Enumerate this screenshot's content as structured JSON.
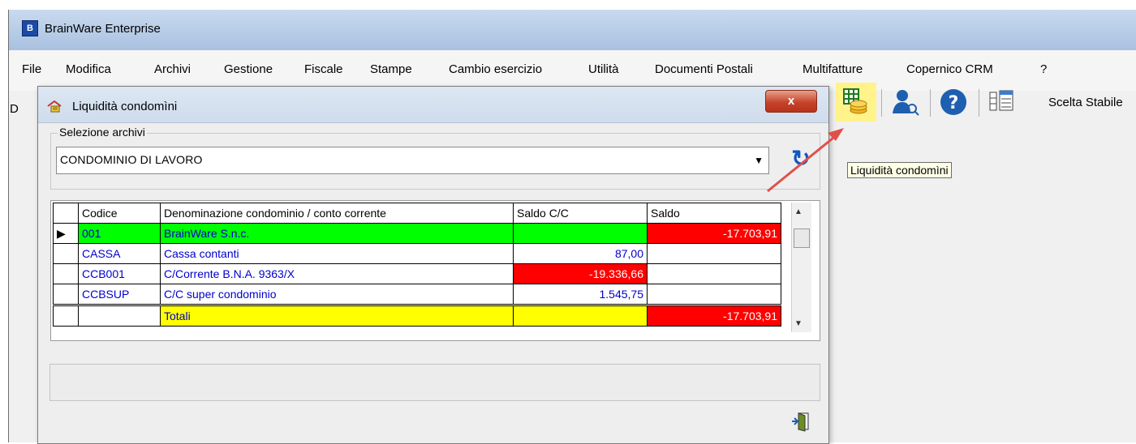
{
  "app": {
    "title": "BrainWare Enterprise",
    "icon_letter": "B"
  },
  "menu": [
    "File",
    "Modifica",
    "Archivi",
    "Gestione",
    "Fiscale",
    "Stampe",
    "Cambio esercizio",
    "Utilità",
    "Documenti Postali",
    "Multifatture",
    "Copernico CRM",
    "?"
  ],
  "toolbar": {
    "buttons": [
      "liquidita-icon",
      "user-search-icon",
      "help-icon",
      "grid-list-icon"
    ],
    "scelta_label": "Scelta Stabile",
    "tooltip": "Liquidità condomìni",
    "clipped_left_char": "D"
  },
  "dialog": {
    "title": "Liquidità condomìni",
    "close_label": "x",
    "group_label": "Selezione archivi",
    "selected_archive": "CONDOMINIO DI LAVORO",
    "columns": [
      "Codice",
      "Denominazione condominio / conto corrente",
      "Saldo C/C",
      "Saldo"
    ],
    "rows": [
      {
        "codice": "001",
        "denominazione": "BrainWare S.n.c.",
        "saldo_cc": "",
        "saldo": "-17.703,91"
      },
      {
        "codice": "CASSA",
        "denominazione": "Cassa contanti",
        "saldo_cc": "87,00",
        "saldo": ""
      },
      {
        "codice": "CCB001",
        "denominazione": "C/Corrente B.N.A. 9363/X",
        "saldo_cc": "-19.336,66",
        "saldo": ""
      },
      {
        "codice": "CCBSUP",
        "denominazione": "C/C super condominio",
        "saldo_cc": "1.545,75",
        "saldo": ""
      }
    ],
    "totals": {
      "label": "Totali",
      "saldo_cc": "",
      "saldo": "-17.703,91"
    }
  },
  "colors": {
    "green_row": "#00ff00",
    "negative": "#ff0000",
    "totals": "#ffff00",
    "highlight": "#fff38a",
    "arrow": "#e0504a"
  }
}
